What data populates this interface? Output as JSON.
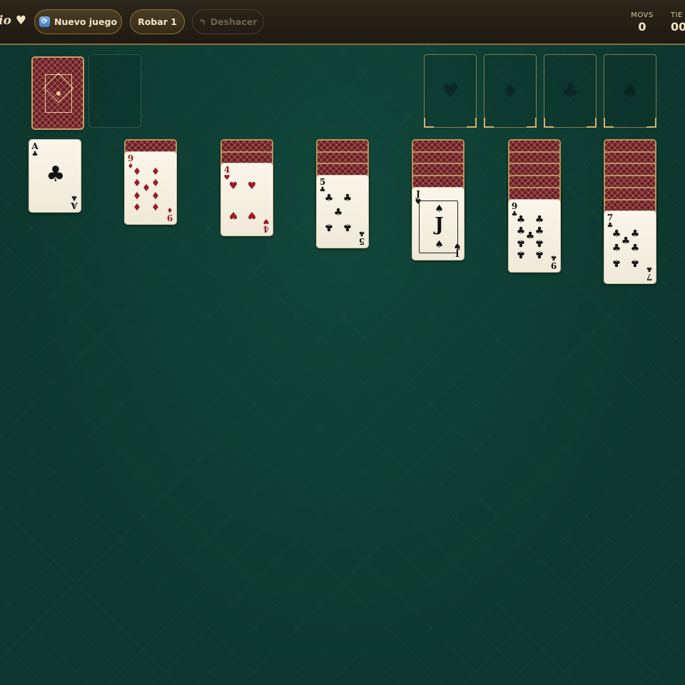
{
  "header": {
    "brand": "io ♥",
    "new_game_label": "Nuevo juego",
    "draw_label": "Robar 1",
    "undo_label": "Deshacer",
    "undo_icon": "↰",
    "refresh_icon": "⟳",
    "moves_label": "MOVS",
    "moves_value": "0",
    "time_label": "TIE",
    "time_value": "00"
  },
  "foundations": [
    {
      "name": "hearts",
      "symbol": "♥"
    },
    {
      "name": "diamonds",
      "symbol": "♦"
    },
    {
      "name": "clubs",
      "symbol": "♣"
    },
    {
      "name": "spades",
      "symbol": "♠"
    }
  ],
  "tableau": [
    {
      "hidden": 0,
      "card": {
        "rank": "A",
        "suit": "♣",
        "color": "black"
      }
    },
    {
      "hidden": 1,
      "card": {
        "rank": "9",
        "suit": "♦",
        "color": "red"
      }
    },
    {
      "hidden": 2,
      "card": {
        "rank": "4",
        "suit": "♥",
        "color": "red"
      }
    },
    {
      "hidden": 3,
      "card": {
        "rank": "5",
        "suit": "♣",
        "color": "black"
      }
    },
    {
      "hidden": 4,
      "card": {
        "rank": "J",
        "suit": "♠",
        "color": "black",
        "corner_suit": "♥"
      }
    },
    {
      "hidden": 5,
      "card": {
        "rank": "9",
        "suit": "♣",
        "color": "black"
      }
    },
    {
      "hidden": 6,
      "card": {
        "rank": "7",
        "suit": "♣",
        "color": "black"
      }
    }
  ],
  "colors": {
    "felt": "#0f3d33",
    "card_back": "#6b1d28",
    "gold": "#b8955a",
    "red_suit": "#9a1c28"
  }
}
